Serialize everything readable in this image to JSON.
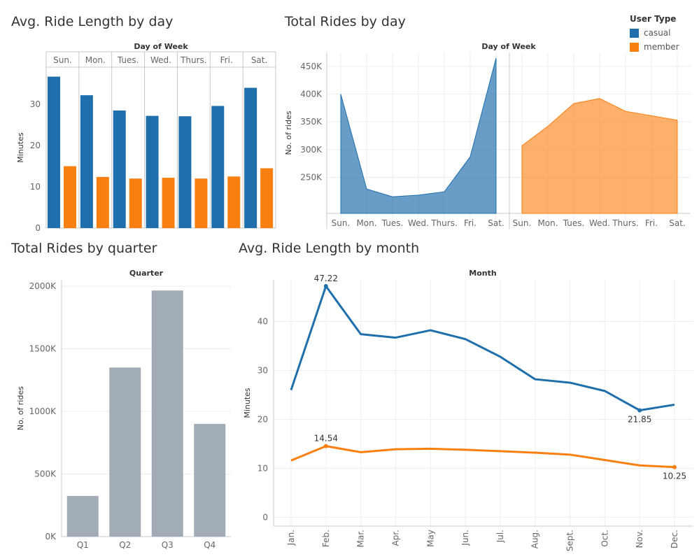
{
  "colors": {
    "casual": "#1f6fad",
    "member": "#fa7f11",
    "quarter": "#a2acb7",
    "grid": "#eeeeee",
    "axis": "#c8c8c8"
  },
  "legend": {
    "title": "User Type",
    "items": [
      {
        "label": "casual",
        "color": "#1f6fad"
      },
      {
        "label": "member",
        "color": "#fa7f11"
      }
    ]
  },
  "chart_data": [
    {
      "id": "avg_ride_day",
      "type": "bar",
      "title": "Avg. Ride Length by day",
      "xlabel": "Day of Week",
      "ylabel": "Minutes",
      "categories": [
        "Sun.",
        "Mon.",
        "Tues.",
        "Wed.",
        "Thurs.",
        "Fri.",
        "Sat."
      ],
      "yticks": [
        0,
        10,
        20,
        30
      ],
      "ylim": [
        0,
        39
      ],
      "series": [
        {
          "name": "casual",
          "values": [
            36.7,
            32.2,
            28.5,
            27.2,
            27.1,
            29.6,
            34.0
          ]
        },
        {
          "name": "member",
          "values": [
            15.0,
            12.4,
            12.0,
            12.2,
            12.0,
            12.5,
            14.5
          ]
        }
      ]
    },
    {
      "id": "total_rides_day",
      "type": "area",
      "title": "Total Rides by day",
      "xlabel": "Day of Week",
      "ylabel": "No. of rides",
      "categories": [
        "Sun.",
        "Mon.",
        "Tues.",
        "Wed.",
        "Thurs.",
        "Fri.",
        "Sat."
      ],
      "yticks_labels": [
        "250K",
        "300K",
        "350K",
        "400K",
        "450K"
      ],
      "yticks": [
        250000,
        300000,
        350000,
        400000,
        450000
      ],
      "ylim": [
        185000,
        475000
      ],
      "series": [
        {
          "name": "casual",
          "values": [
            400000,
            229000,
            215000,
            218000,
            224000,
            287000,
            465000
          ]
        },
        {
          "name": "member",
          "values": [
            307000,
            342000,
            383000,
            392000,
            369000,
            361000,
            353000
          ]
        }
      ]
    },
    {
      "id": "total_rides_quarter",
      "type": "bar",
      "title": "Total Rides by quarter",
      "xlabel": "Quarter",
      "ylabel": "No. of rides",
      "categories": [
        "Q1",
        "Q2",
        "Q3",
        "Q4"
      ],
      "yticks_labels": [
        "0K",
        "500K",
        "1000K",
        "1500K",
        "2000K"
      ],
      "yticks": [
        0,
        500000,
        1000000,
        1500000,
        2000000
      ],
      "ylim": [
        0,
        2050000
      ],
      "values": [
        325000,
        1350000,
        1965000,
        900000
      ]
    },
    {
      "id": "avg_ride_month",
      "type": "line",
      "title": "Avg. Ride Length by month",
      "xlabel": "Month",
      "ylabel": "Minutes",
      "categories": [
        "Jan.",
        "Feb.",
        "Mar.",
        "Apr.",
        "May",
        "Jun.",
        "Jul.",
        "Aug.",
        "Sept.",
        "Oct.",
        "Nov.",
        "Dec."
      ],
      "yticks": [
        0,
        10,
        20,
        30,
        40
      ],
      "ylim": [
        -1.8,
        48.5
      ],
      "series": [
        {
          "name": "casual",
          "values": [
            26.0,
            47.22,
            37.4,
            36.7,
            38.2,
            36.4,
            32.8,
            28.2,
            27.5,
            25.8,
            21.85,
            23.0
          ]
        },
        {
          "name": "member",
          "values": [
            11.6,
            14.54,
            13.3,
            13.9,
            14.0,
            13.8,
            13.5,
            13.2,
            12.8,
            11.7,
            10.6,
            10.25
          ]
        }
      ],
      "annotations": [
        {
          "series": "casual",
          "category": "Feb.",
          "label": "47.22"
        },
        {
          "series": "casual",
          "category": "Nov.",
          "label": "21.85"
        },
        {
          "series": "member",
          "category": "Feb.",
          "label": "14.54"
        },
        {
          "series": "member",
          "category": "Dec.",
          "label": "10.25"
        }
      ]
    }
  ]
}
